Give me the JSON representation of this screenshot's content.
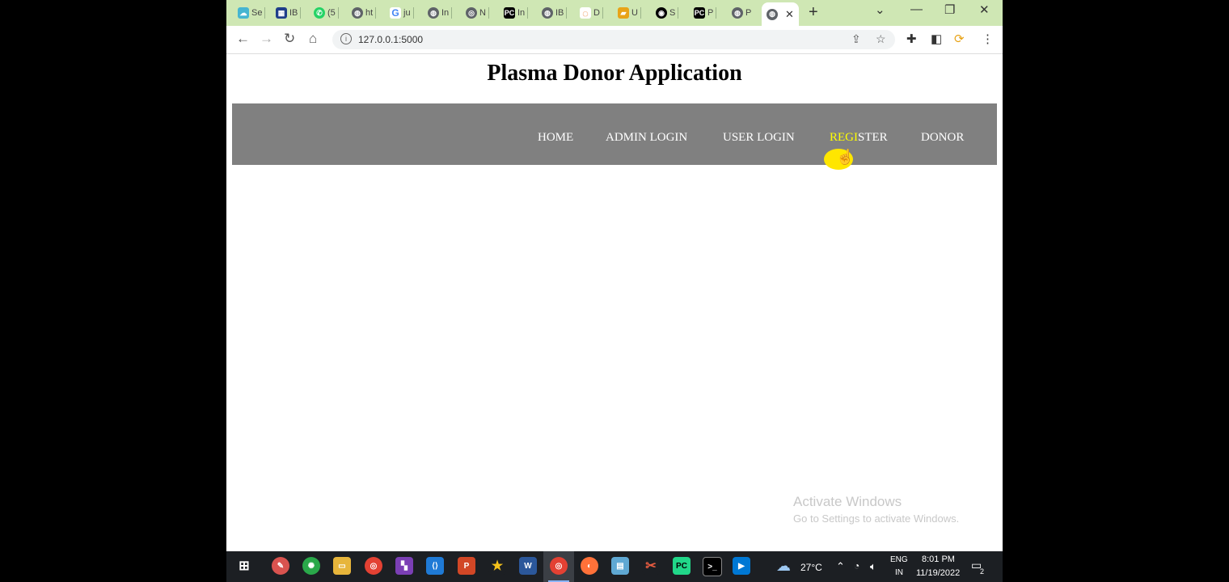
{
  "browser": {
    "tabs": [
      {
        "label": "Se",
        "icon": "cloud-icon",
        "color": "#46b5d1"
      },
      {
        "label": "IB",
        "icon": "grid-icon",
        "color": "#1f3e8a"
      },
      {
        "label": "(5",
        "icon": "whatsapp-icon",
        "color": "#25d366"
      },
      {
        "label": "ht",
        "icon": "globe-icon",
        "color": "#5f6368"
      },
      {
        "label": "ju",
        "icon": "google-icon",
        "color": "#4285f4"
      },
      {
        "label": "In",
        "icon": "globe-icon",
        "color": "#5f6368"
      },
      {
        "label": "N",
        "icon": "chrome-icon",
        "color": "#5f6368"
      },
      {
        "label": "In",
        "icon": "pycharm-icon",
        "color": "#000000"
      },
      {
        "label": "IB",
        "icon": "globe-icon",
        "color": "#5f6368"
      },
      {
        "label": "D",
        "icon": "arc-icon",
        "color": "#e8711a"
      },
      {
        "label": "U",
        "icon": "book-icon",
        "color": "#e8a317"
      },
      {
        "label": "S",
        "icon": "github-icon",
        "color": "#000000"
      },
      {
        "label": "P",
        "icon": "pycharm-icon",
        "color": "#000000"
      },
      {
        "label": "P",
        "icon": "globe-icon",
        "color": "#5f6368"
      }
    ],
    "active_tab": {
      "icon": "globe-icon",
      "close": "✕"
    },
    "new_tab": "+",
    "url": "127.0.0.1:5000"
  },
  "page": {
    "title": "Plasma Donor Application",
    "nav": [
      {
        "label": "HOME"
      },
      {
        "label": "ADMIN LOGIN"
      },
      {
        "label": "USER LOGIN"
      },
      {
        "label_hl": "REGI",
        "label_rest": "STER"
      },
      {
        "label": "DONOR"
      }
    ],
    "navbar_color": "#808080",
    "highlight_color": "#ffff00"
  },
  "watermark": {
    "line1": "Activate Windows",
    "line2": "Go to Settings to activate Windows."
  },
  "taskbar": {
    "weather": "27°C",
    "lang1": "ENG",
    "lang2": "IN",
    "time": "8:01 PM",
    "date": "11/19/2022",
    "notif_count": "2"
  }
}
